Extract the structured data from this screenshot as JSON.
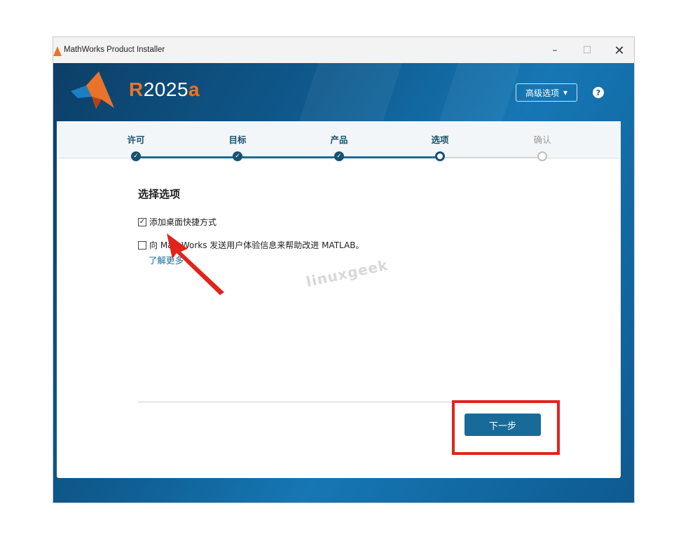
{
  "window": {
    "title": "MathWorks Product Installer",
    "controls": {
      "minimize": "–",
      "maximize": "☐",
      "close": "✕"
    }
  },
  "header": {
    "release_prefix": "R",
    "release_number": "2025",
    "release_suffix": "a",
    "advanced_options_label": "高级选项",
    "advanced_caret": "▾",
    "help_label": "?"
  },
  "stepper": {
    "steps": [
      {
        "label": "许可",
        "state": "done"
      },
      {
        "label": "目标",
        "state": "done"
      },
      {
        "label": "产品",
        "state": "done"
      },
      {
        "label": "选项",
        "state": "current"
      },
      {
        "label": "确认",
        "state": "pending"
      }
    ]
  },
  "options": {
    "title": "选择选项",
    "desktop_shortcut": {
      "label": "添加桌面快捷方式",
      "checked": true,
      "mark": "✓"
    },
    "send_experience": {
      "label": "向 MathWorks 发送用户体验信息来帮助改进 MATLAB。",
      "checked": false
    },
    "learn_more": "了解更多"
  },
  "watermark": "linuxgeek",
  "footer": {
    "next_label": "下一步"
  },
  "colors": {
    "accent": "#186a99",
    "brand_orange": "#e8742b",
    "annotation_red": "#e0241b"
  }
}
